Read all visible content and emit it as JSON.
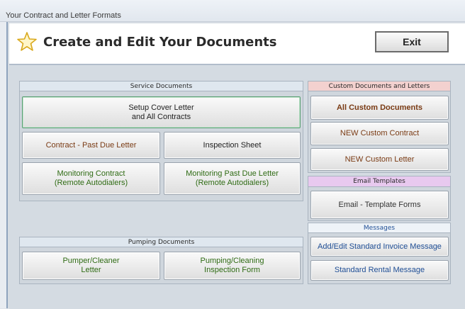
{
  "window": {
    "title": "Your Contract and Letter Formats"
  },
  "header": {
    "title": "Create and Edit Your Documents",
    "exit_label": "Exit"
  },
  "service_documents": {
    "heading": "Service Documents",
    "buttons": {
      "setup_cover": "Setup Cover Letter\nand All Contracts",
      "contract_past_due": "Contract - Past Due Letter",
      "inspection_sheet": "Inspection Sheet",
      "monitoring_contract": "Monitoring Contract\n(Remote Autodialers)",
      "monitoring_past_due": "Monitoring Past Due Letter\n(Remote Autodialers)"
    }
  },
  "pumping_documents": {
    "heading": "Pumping Documents",
    "buttons": {
      "pumper_cleaner": "Pumper/Cleaner\nLetter",
      "pumping_inspection": "Pumping/Cleaning\nInspection Form"
    }
  },
  "custom_documents": {
    "heading": "Custom Documents and Letters",
    "buttons": {
      "all_custom": "All Custom Documents",
      "new_contract": "NEW Custom Contract",
      "new_letter": "NEW Custom Letter"
    }
  },
  "email_templates": {
    "heading": "Email Templates",
    "buttons": {
      "template_forms": "Email - Template Forms"
    }
  },
  "messages": {
    "heading": "Messages",
    "buttons": {
      "invoice_message": "Add/Edit Standard Invoice Message",
      "rental_message": "Standard Rental Message"
    }
  },
  "colors": {
    "custom_header": "#f3d1cf",
    "email_header": "#e8c9ef",
    "messages_header": "#eef3f8",
    "service_header": "#dfe7ef"
  }
}
